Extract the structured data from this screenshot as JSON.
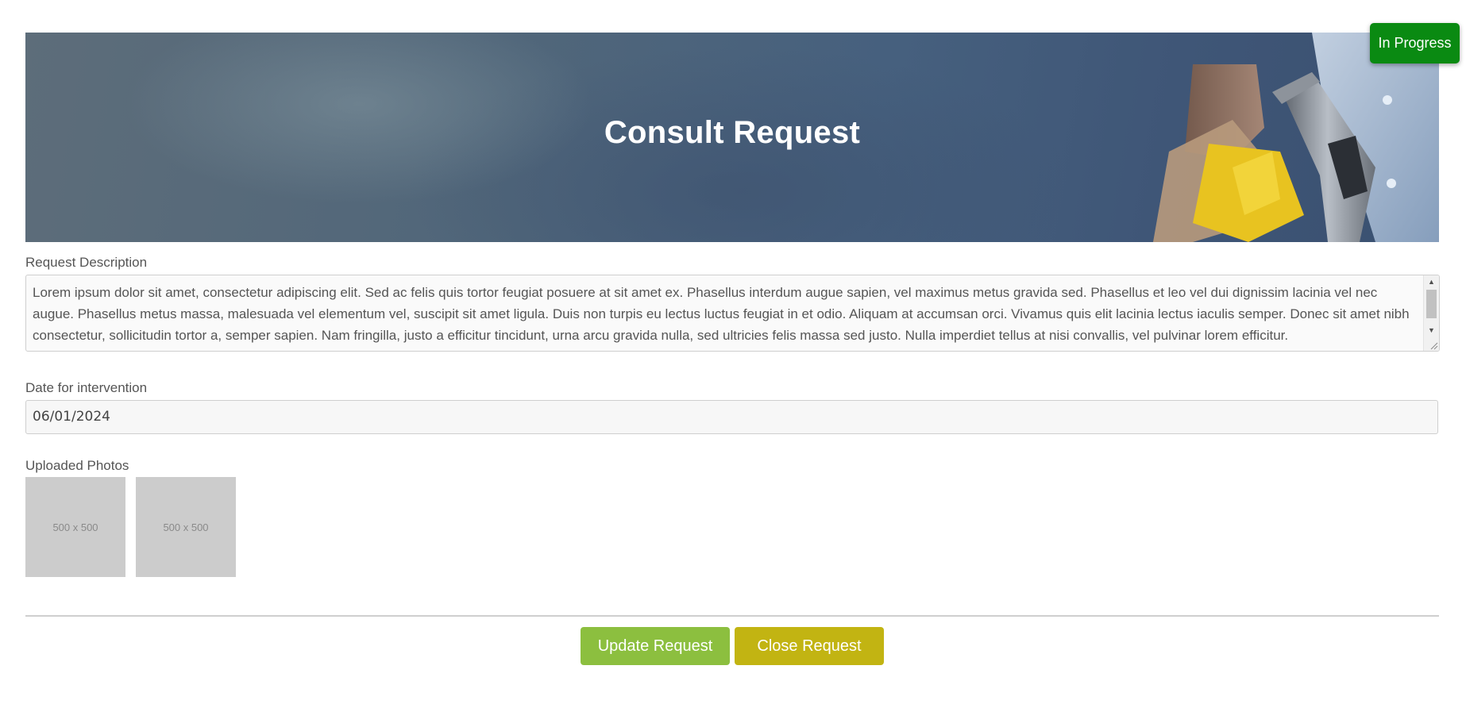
{
  "status": {
    "label": "In Progress",
    "color": "#0a8a12"
  },
  "hero": {
    "title": "Consult Request"
  },
  "description": {
    "label": "Request Description",
    "value": "Lorem ipsum dolor sit amet, consectetur adipiscing elit. Sed ac felis quis tortor feugiat posuere at sit amet ex. Phasellus interdum augue sapien, vel maximus metus gravida sed. Phasellus et leo vel dui dignissim lacinia vel nec augue. Phasellus metus massa, malesuada vel elementum vel, suscipit sit amet ligula. Duis non turpis eu lectus luctus feugiat in et odio. Aliquam at accumsan orci. Vivamus quis elit lacinia lectus iaculis semper. Donec sit amet nibh consectetur, sollicitudin tortor a, semper sapien. Nam fringilla, justo a efficitur tincidunt, urna arcu gravida nulla, sed ultricies felis massa sed justo. Nulla imperdiet tellus at nisi convallis, vel pulvinar lorem efficitur."
  },
  "date": {
    "label": "Date for intervention",
    "value": "06/01/2024"
  },
  "photos": {
    "label": "Uploaded Photos",
    "items": [
      {
        "caption": "500 x 500"
      },
      {
        "caption": "500 x 500"
      }
    ]
  },
  "actions": {
    "update_label": "Update Request",
    "update_color": "#8cbf3f",
    "close_label": "Close Request",
    "close_color": "#c2b412"
  }
}
